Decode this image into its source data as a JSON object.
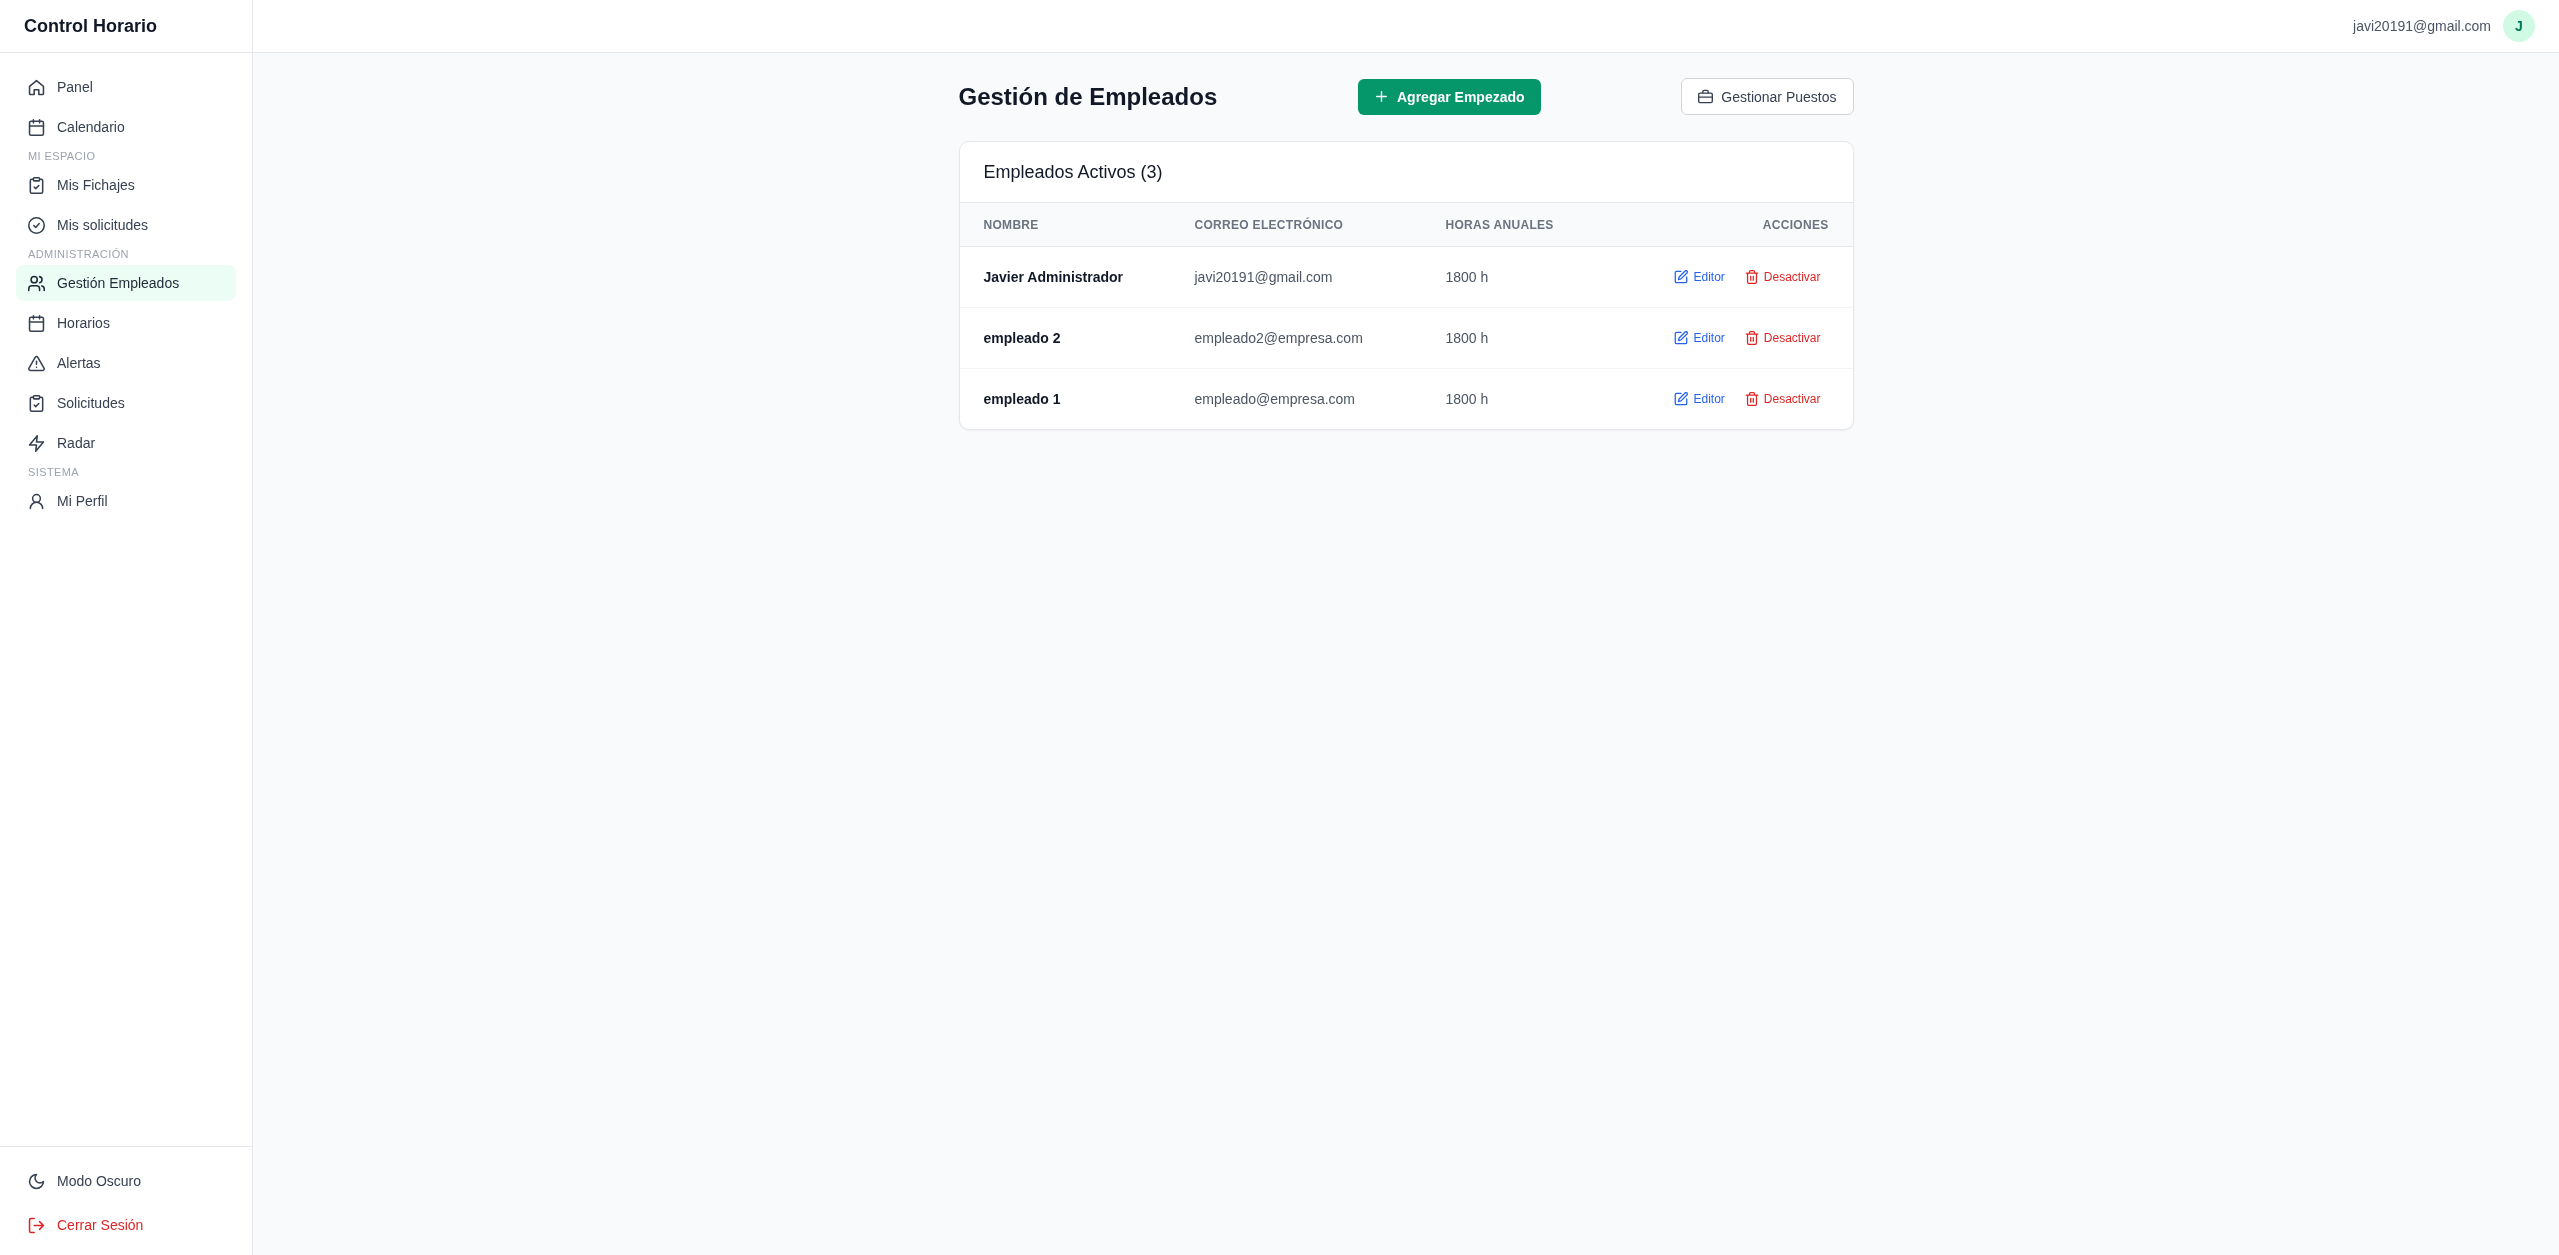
{
  "sidebar": {
    "title": "Control Horario",
    "groups": [
      {
        "items": [
          {
            "label": "Panel",
            "selected": false
          },
          {
            "label": "Calendario",
            "selected": false
          }
        ]
      },
      {
        "heading": "MI ESPACIO",
        "items": [
          {
            "label": "Mis Fichajes",
            "selected": false
          },
          {
            "label": "Mis solicitudes",
            "selected": false
          }
        ]
      },
      {
        "heading": "ADMINISTRACIÓN",
        "items": [
          {
            "label": "Gestión Empleados",
            "selected": true
          },
          {
            "label": "Horarios",
            "selected": false
          },
          {
            "label": "Alertas",
            "selected": false
          },
          {
            "label": "Solicitudes",
            "selected": false
          },
          {
            "label": "Radar",
            "selected": false
          }
        ]
      },
      {
        "heading": "SISTEMA",
        "items": [
          {
            "label": "Mi Perfil",
            "selected": false
          }
        ]
      }
    ],
    "footer": [
      {
        "label": "Modo Oscuro",
        "kind": "theme"
      },
      {
        "label": "Cerrar Sesión",
        "kind": "logout"
      }
    ]
  },
  "header": {
    "user_email": "javi20191@gmail.com",
    "avatar_initial": "J"
  },
  "page": {
    "title": "Gestión de Empleados",
    "actions": [
      {
        "label": "Agregar Empezado",
        "kind": "primary"
      },
      {
        "label": "Gestionar Puestos",
        "kind": "secondary"
      }
    ]
  },
  "table": {
    "title": "Empleados Activos (3)",
    "columns": [
      "NOMBRE",
      "CORREO ELECTRÓNICO",
      "HORAS ANUALES",
      "ACCIONES"
    ],
    "rows": [
      {
        "name": "Javier Administrador",
        "email": "javi20191@gmail.com",
        "hours": "1800 h",
        "actions": [
          {
            "label": "Editor",
            "kind": "edit"
          },
          {
            "label": "Desactivar",
            "kind": "deactivate"
          }
        ]
      },
      {
        "name": "empleado 2",
        "email": "empleado2@empresa.com",
        "hours": "1800 h",
        "actions": [
          {
            "label": "Editor",
            "kind": "edit"
          },
          {
            "label": "Desactivar",
            "kind": "deactivate"
          }
        ]
      },
      {
        "name": "empleado 1",
        "email": "empleado@empresa.com",
        "hours": "1800 h",
        "actions": [
          {
            "label": "Editor",
            "kind": "edit"
          },
          {
            "label": "Desactivar",
            "kind": "deactivate"
          }
        ]
      }
    ]
  }
}
